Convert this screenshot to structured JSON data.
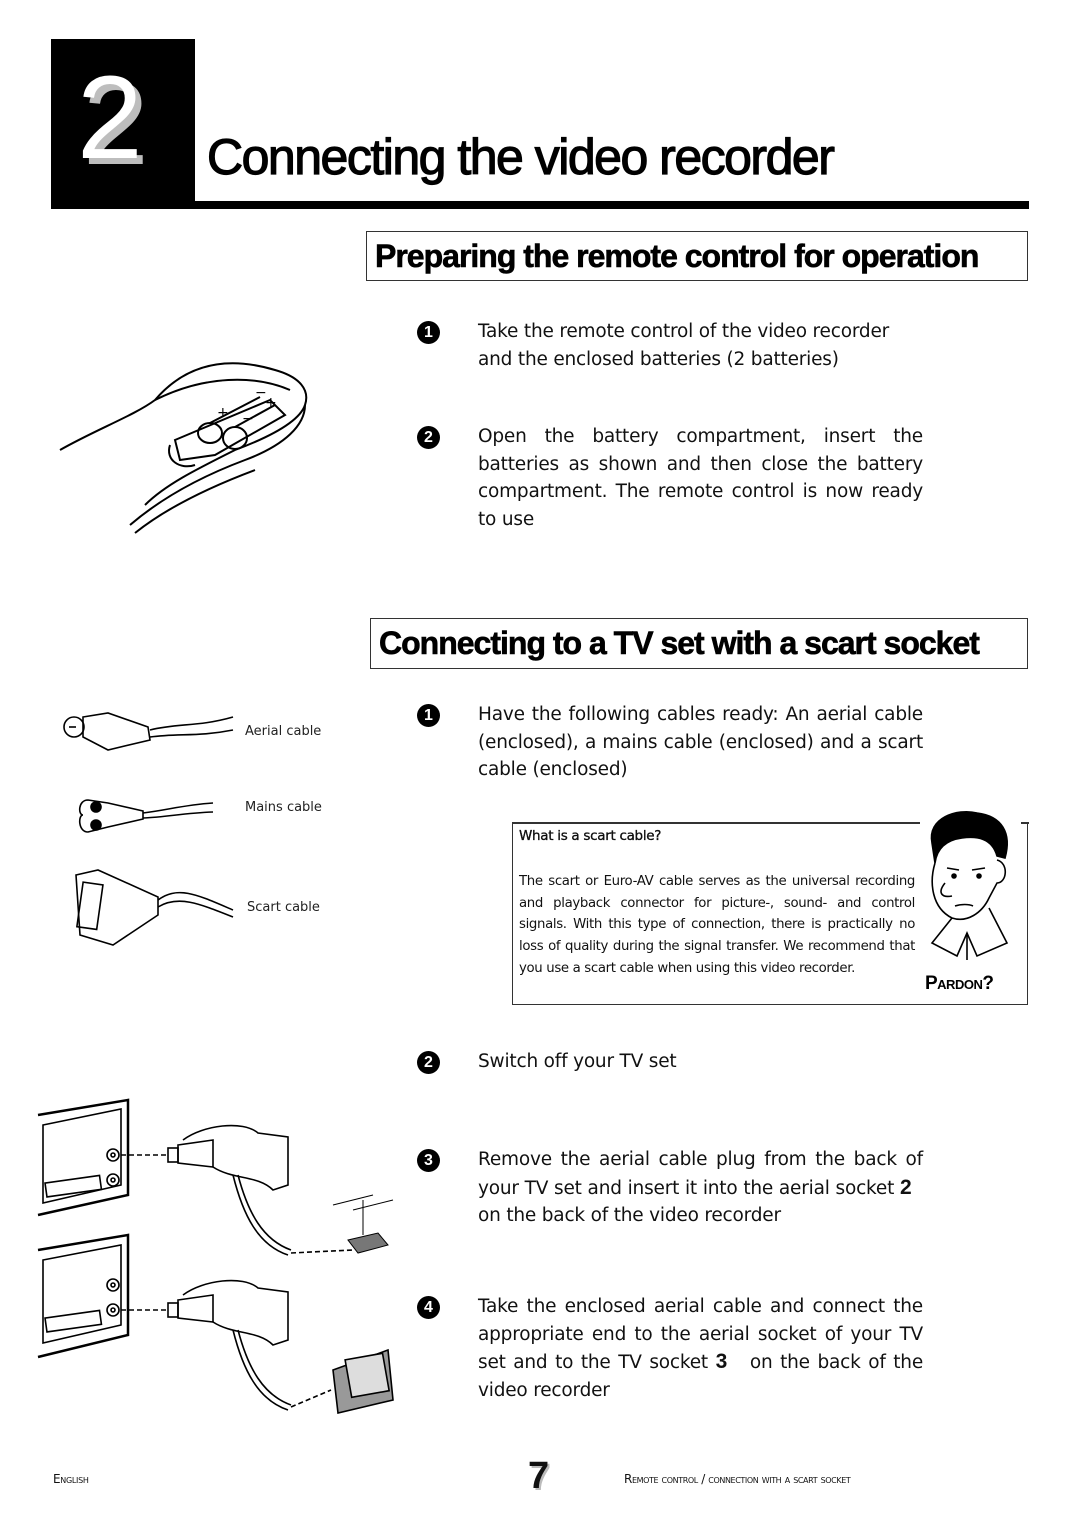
{
  "chapter": {
    "number": "2",
    "title": "Connecting the video recorder"
  },
  "sections": [
    {
      "title": "Preparing the remote control for operation",
      "steps": [
        {
          "number": "1",
          "text": "Take the remote control of the video recorder and the enclosed batteries (2 batteries)"
        },
        {
          "number": "2",
          "text": "Open the battery compartment, insert the batteries as shown and then close the battery compartment. The remote control is now ready to use"
        }
      ]
    },
    {
      "title": "Connecting to a TV set with a scart socket",
      "steps": [
        {
          "number": "1",
          "text": "Have the following cables ready: An aerial cable (enclosed), a mains cable (enclosed) and a scart cable (enclosed)"
        },
        {
          "number": "2",
          "text": "Switch off your TV set"
        },
        {
          "number": "3",
          "text_before": "Remove the aerial cable plug from the back of your TV set and insert it into the aerial socket",
          "socket": "2",
          "text_after": "on the back of the video recorder"
        },
        {
          "number": "4",
          "text_before": "Take the enclosed aerial cable and connect the appropriate end to the aerial socket of your TV set and to the TV socket",
          "socket": "3",
          "text_after": "on the back of the video recorder"
        }
      ]
    }
  ],
  "cables": [
    {
      "label": "Aerial cable",
      "icon": "aerial-plug-icon"
    },
    {
      "label": "Mains cable",
      "icon": "mains-plug-icon"
    },
    {
      "label": "Scart cable",
      "icon": "scart-plug-icon"
    }
  ],
  "info_box": {
    "title": "What is a scart cable?",
    "body": "The scart or Euro-AV cable serves as the universal recording and playback connector for picture-, sound- and control signals. With this type of connection, there is practically no loss of quality during the signal transfer. We recommend that you use a scart cable when using this video recorder.",
    "caption": "Pardon?"
  },
  "footer": {
    "language": "English",
    "page": "7",
    "section": "Remote control / connection with a scart socket"
  }
}
